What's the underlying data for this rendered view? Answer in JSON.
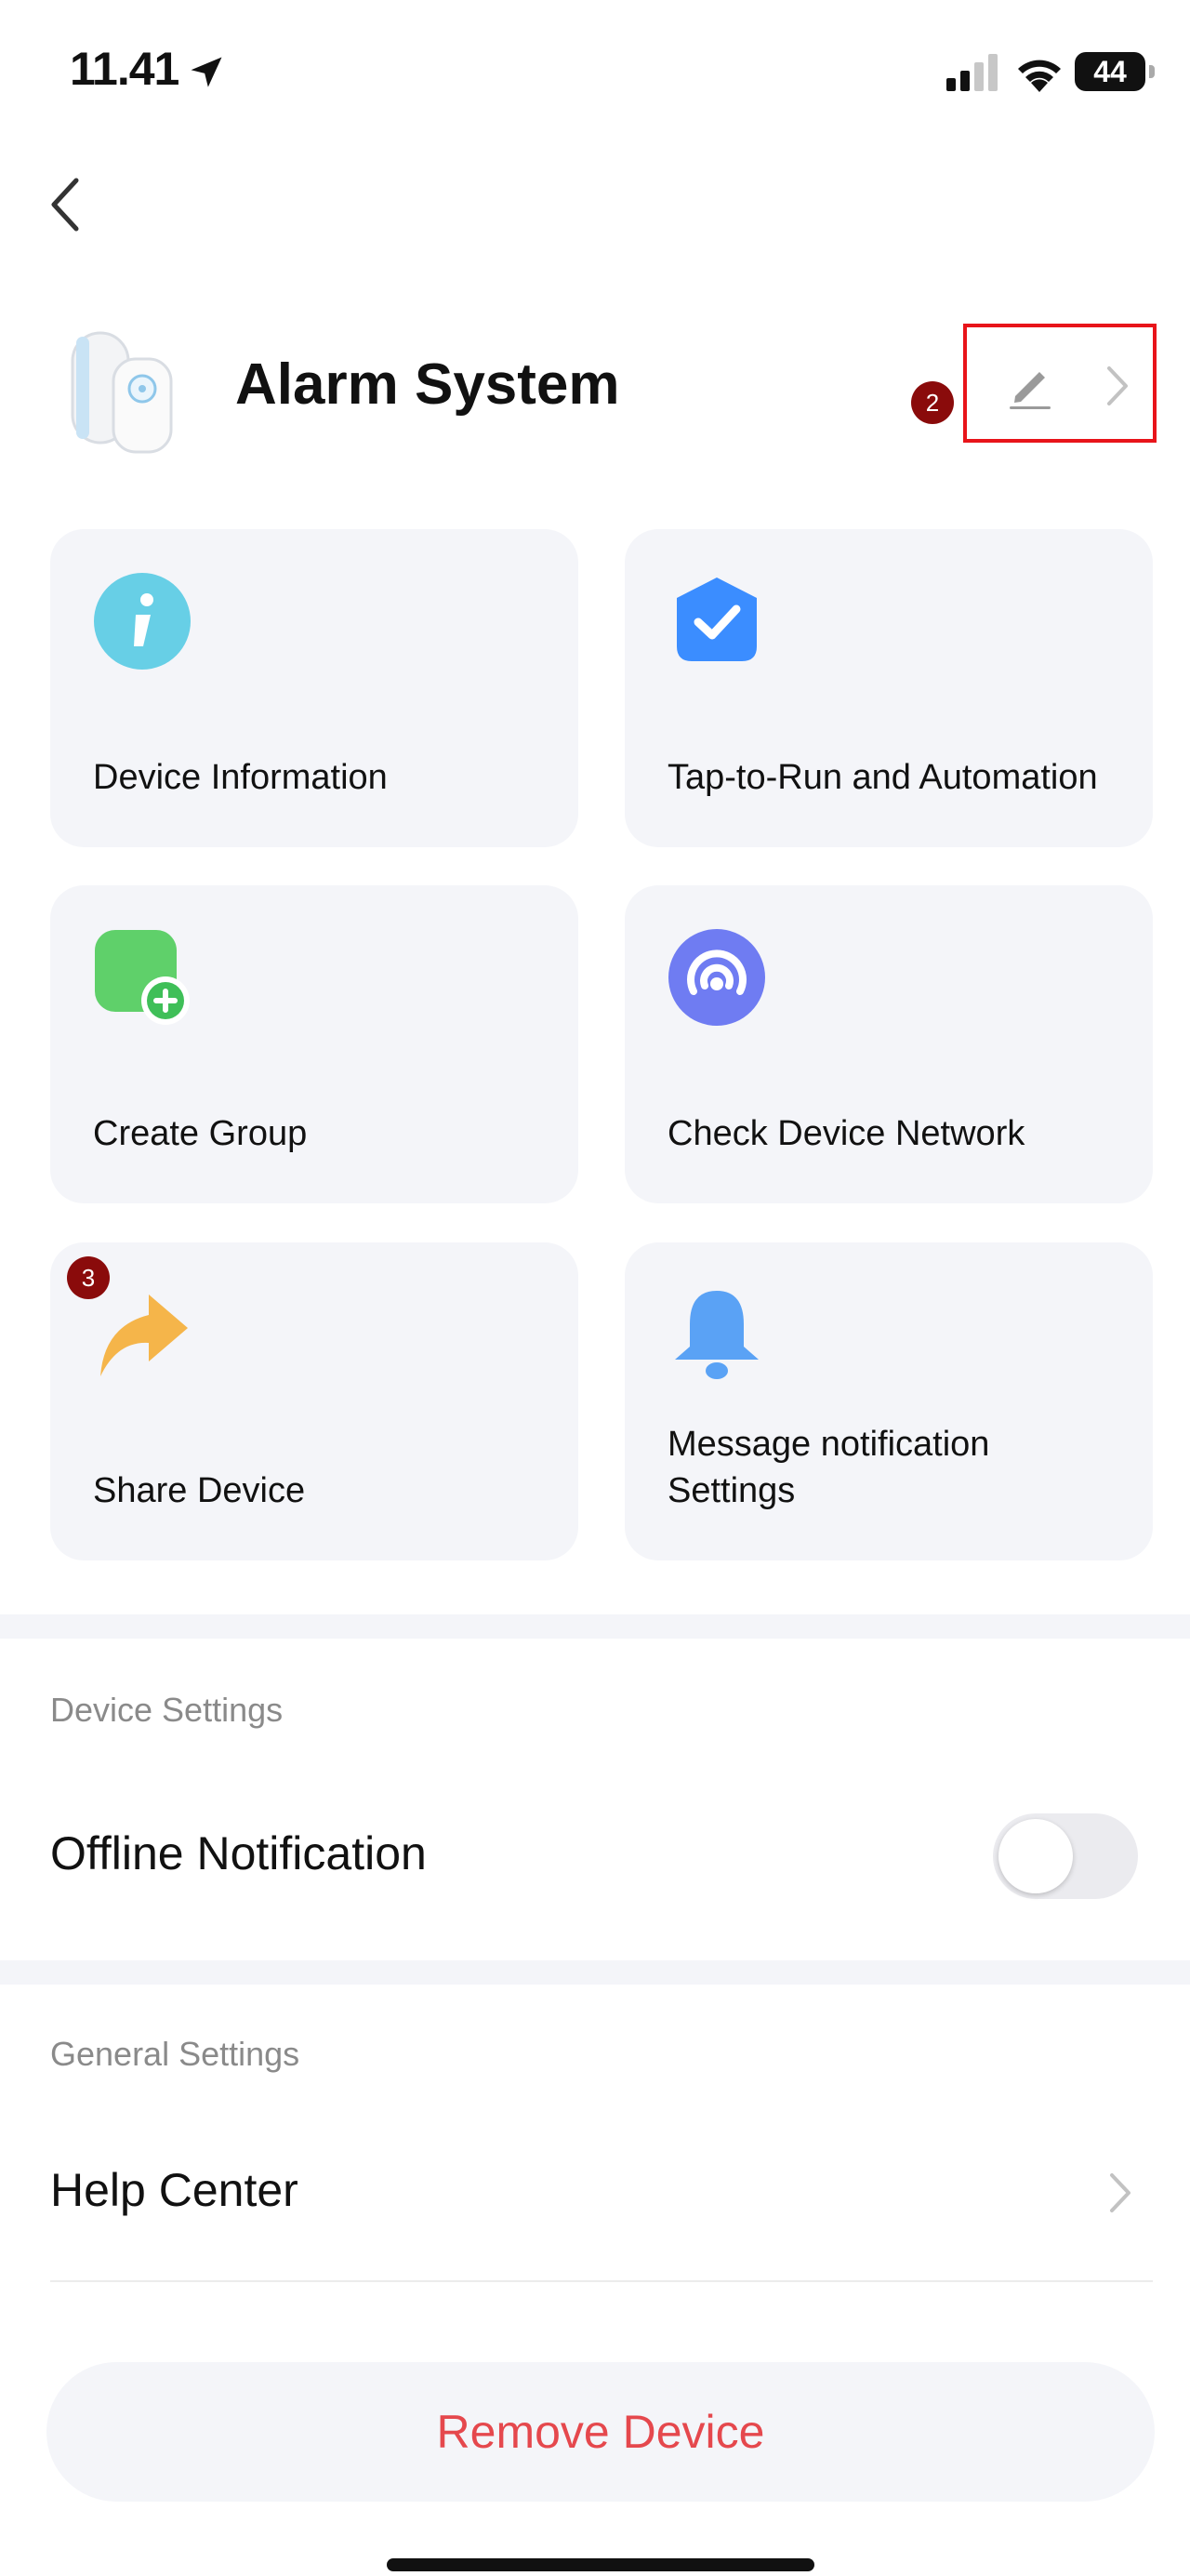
{
  "status_bar": {
    "time": "11.41",
    "battery": "44"
  },
  "header": {
    "title": "Alarm System",
    "marker_edit": "2"
  },
  "cards": [
    {
      "label": "Device Information",
      "icon": "info-icon"
    },
    {
      "label": "Tap-to-Run and Automation",
      "icon": "shield-check-icon"
    },
    {
      "label": "Create Group",
      "icon": "add-group-icon"
    },
    {
      "label": "Check Device Network",
      "icon": "network-icon"
    },
    {
      "label": "Share Device",
      "icon": "share-icon",
      "marker": "3"
    },
    {
      "label": "Message notification Settings",
      "icon": "bell-icon"
    }
  ],
  "device_settings": {
    "section_title": "Device Settings",
    "offline_notification": {
      "label": "Offline Notification",
      "enabled": false
    }
  },
  "general_settings": {
    "section_title": "General Settings",
    "help_center": "Help Center"
  },
  "remove_button": "Remove Device",
  "colors": {
    "accent_red": "#e5484d",
    "highlight_box": "#e8141a",
    "card_bg": "#f4f5f9",
    "marker": "#8a0b0b"
  }
}
